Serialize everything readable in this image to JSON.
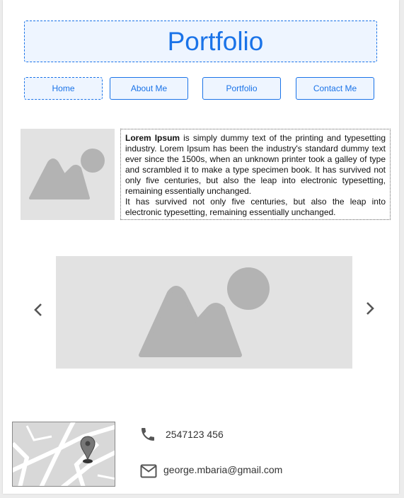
{
  "header": {
    "title": "Portfolio"
  },
  "nav": {
    "items": [
      {
        "label": "Home"
      },
      {
        "label": "About Me"
      },
      {
        "label": "Portfolio"
      },
      {
        "label": "Contact Me"
      }
    ]
  },
  "intro": {
    "bold": "Lorem Ipsum",
    "paragraph1": " is simply dummy text of the printing and typesetting industry. Lorem Ipsum has been the industry's standard dummy text ever since the 1500s, when an unknown printer took a galley of type and scrambled it to make a type specimen book. It has survived not only five centuries, but also the leap into electronic typesetting, remaining essentially unchanged.",
    "paragraph2": "It has survived not only five centuries, but also the leap into electronic typesetting, remaining essentially unchanged."
  },
  "carousel": {
    "prev_icon": "chevron-left-icon",
    "next_icon": "chevron-right-icon"
  },
  "contact": {
    "phone": "2547123 456",
    "email": "george.mbaria@gmail.com",
    "phone_icon": "phone-icon",
    "email_icon": "mail-icon",
    "map_icon": "map-pin-icon"
  },
  "colors": {
    "accent": "#1a73e8",
    "accent_bg": "#eef5ff",
    "placeholder_bg": "#e2e2e2",
    "placeholder_fg": "#b3b3b3"
  }
}
